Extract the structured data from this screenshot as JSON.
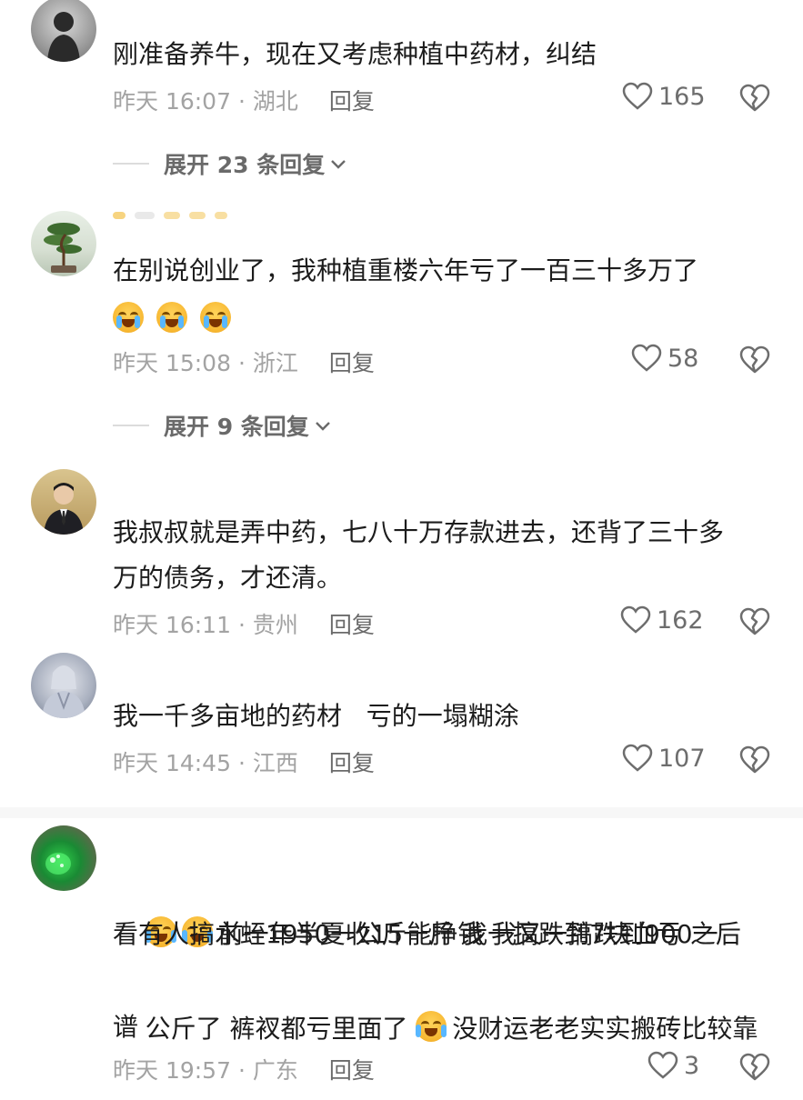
{
  "comments": [
    {
      "text": "刚准备养牛，现在又考虑种植中药材，纠结",
      "time": "昨天 16:07 · 湖北",
      "reply_label": "回复",
      "likes": "165",
      "expand_label": "展开 23 条回复"
    },
    {
      "text": "在别说创业了，我种植重楼六年亏了一百三十多万了",
      "time": "昨天 15:08 · 浙江",
      "reply_label": "回复",
      "likes": "58",
      "expand_label": "展开 9 条回复"
    },
    {
      "text_line1": "我叔叔就是弄中药，七八十万存款进去，还背了三十多",
      "text_line2": "万的债务，才还清。",
      "time": "昨天 16:11 · 贵州",
      "reply_label": "回复",
      "likes": "162"
    },
    {
      "text": "我一千多亩地的药材   亏的一塌糊涂",
      "time": "昨天 14:45 · 江西",
      "reply_label": "回复",
      "likes": "107"
    },
    {
      "text_line1": "前一年半夏收15一斤 我一搞跌到7块血亏 之后",
      "text_line2": "看有人搞水蛭1950一公斤能挣钱 我又一搞跌到900一",
      "text_line3a": "公斤了 裤衩都亏里面了 ",
      "text_line3b": "没财运老老实实搬砖比较靠",
      "text_line4": "谱",
      "time": "昨天 19:57 · 广东",
      "reply_label": "回复",
      "likes": "3"
    }
  ],
  "colors": {
    "meta": "#a3a3a3",
    "reply": "#6b6b6b",
    "text": "#1c1c1c",
    "emoji": "#f7b731"
  }
}
